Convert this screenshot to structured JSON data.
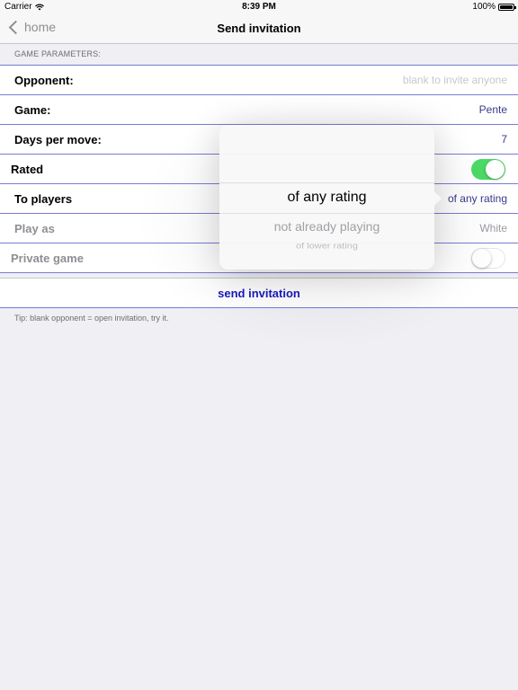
{
  "status_bar": {
    "carrier": "Carrier",
    "time": "8:39 PM",
    "battery": "100%"
  },
  "nav": {
    "back_label": "home",
    "title": "Send invitation"
  },
  "section_header": "GAME PARAMETERS:",
  "rows": {
    "opponent": {
      "label": "Opponent:",
      "placeholder": "blank to invite anyone"
    },
    "game": {
      "label": "Game:",
      "value": "Pente"
    },
    "days_per_move": {
      "label": "Days per move:",
      "value": "7"
    },
    "rated": {
      "label": "Rated",
      "on": true
    },
    "to_players": {
      "label": "To players",
      "value": "of any rating"
    },
    "play_as": {
      "label": "Play as",
      "value": "White"
    },
    "private_game": {
      "label": "Private game",
      "on": false
    }
  },
  "send_label": "send invitation",
  "tip": "Tip: blank opponent = open invitation, try it.",
  "picker": {
    "options": [
      "of any rating",
      "not already playing",
      "of lower rating"
    ]
  },
  "colors": {
    "accent": "#1a1ac0",
    "divider": "#7a7ad6",
    "toggle_on": "#4cd964"
  }
}
